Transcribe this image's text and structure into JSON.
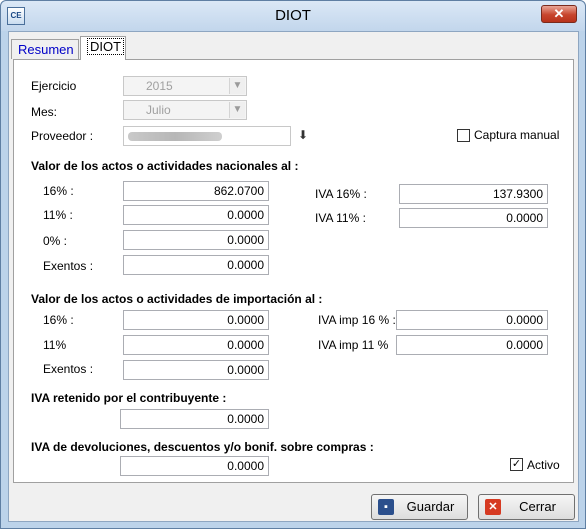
{
  "window": {
    "title": "DIOT",
    "app_icon": "CE",
    "close": "✕"
  },
  "tabs": [
    {
      "label": "Resumen"
    },
    {
      "label": "DIOT"
    }
  ],
  "general": {
    "ejercicio_label": "Ejercicio",
    "ejercicio_value": "2015",
    "mes_label": "Mes:",
    "mes_value": "Julio",
    "proveedor_label": "Proveedor :",
    "captura_manual_label": "Captura manual",
    "captura_manual_checked": false
  },
  "nacionales": {
    "title": "Valor de los actos o actividades nacionales al :",
    "rows": [
      {
        "label": "16% :",
        "value": "862.0700"
      },
      {
        "label": "11% :",
        "value": "0.0000"
      },
      {
        "label": "0% :",
        "value": "0.0000"
      },
      {
        "label": "Exentos :",
        "value": "0.0000"
      }
    ],
    "iva16_label": "IVA 16% :",
    "iva16_value": "137.9300",
    "iva11_label": "IVA 11% :",
    "iva11_value": "0.0000"
  },
  "importacion": {
    "title": "Valor de los actos o actividades de importación al :",
    "rows": [
      {
        "label": "16% :",
        "value": "0.0000"
      },
      {
        "label": "11%",
        "value": "0.0000"
      },
      {
        "label": "Exentos :",
        "value": "0.0000"
      }
    ],
    "iva16_label": "IVA imp 16 % :",
    "iva16_value": "0.0000",
    "iva11_label": "IVA imp 11 %",
    "iva11_value": "0.0000"
  },
  "iva_retenido": {
    "title": "IVA retenido por el contribuyente :",
    "value": "0.0000"
  },
  "iva_devoluciones": {
    "title": "IVA de devoluciones, descuentos y/o bonif. sobre compras :",
    "value": "0.0000"
  },
  "activo": {
    "label": "Activo",
    "checked": true
  },
  "buttons": {
    "guardar": "Guardar",
    "cerrar": "Cerrar"
  },
  "colors": {
    "titlebar": "#c2d6ec",
    "close": "#c7452d",
    "tab_text": "#0000c8"
  }
}
